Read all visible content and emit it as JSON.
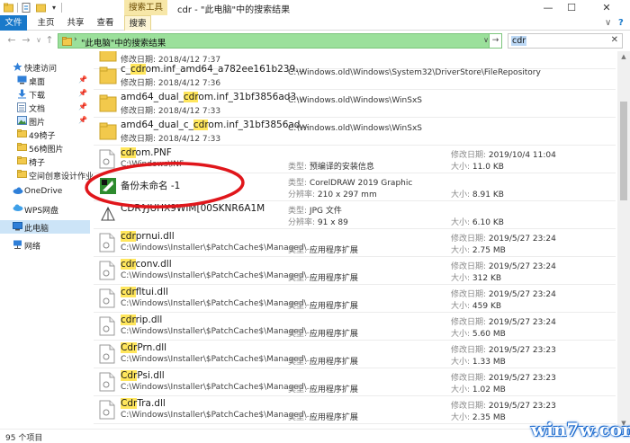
{
  "window": {
    "contextual_tab": "搜索工具",
    "title": "cdr - \"此电脑\"中的搜索结果",
    "minimize": "—",
    "maximize": "☐",
    "close": "✕"
  },
  "ribbon": {
    "tabs": [
      "文件",
      "主页",
      "共享",
      "查看",
      "搜索"
    ],
    "collapse": "∨",
    "help": "?"
  },
  "address_bar": {
    "arrow": "›",
    "location": "\"此电脑\"中的搜索结果",
    "dropdown": "∨",
    "refresh": "→"
  },
  "search": {
    "value": "cdr",
    "clear": "✕"
  },
  "nav_pane": {
    "quick_access": "快速访问",
    "pinned": [
      {
        "label": "桌面",
        "icon": "desktop-icon"
      },
      {
        "label": "下载",
        "icon": "download-icon"
      },
      {
        "label": "文档",
        "icon": "document-icon"
      },
      {
        "label": "图片",
        "icon": "picture-icon"
      }
    ],
    "folders": [
      "49椅子",
      "56椅图片",
      "椅子",
      "空间创意设计作业"
    ],
    "onedrive": "OneDrive",
    "wps": "WPS网盘",
    "this_pc": "此电脑",
    "network": "网络"
  },
  "files": [
    {
      "name": "",
      "sub": "修改日期: 2018/4/12 7:37",
      "path": "",
      "type": "",
      "date": "",
      "size": "",
      "icon": "folder-icon"
    },
    {
      "name": "c_cdrom.inf_amd64_a782ee161b239...",
      "hl": "cdr",
      "sub": "修改日期: 2018/4/12 7:36",
      "path": "C:\\Windows.old\\Windows\\System32\\DriverStore\\FileRepository",
      "type": "",
      "date": "",
      "size": "",
      "icon": "folder-icon"
    },
    {
      "name": "amd64_dual_cdrom.inf_31bf3856ad3...",
      "hl": "cdr",
      "sub": "修改日期: 2018/4/12 7:33",
      "path": "C:\\Windows.old\\Windows\\WinSxS",
      "type": "",
      "date": "",
      "size": "",
      "icon": "folder-icon"
    },
    {
      "name": "amd64_dual_c_cdrom.inf_31bf3856ad...",
      "hl": "cdr",
      "sub": "修改日期: 2018/4/12 7:33",
      "path": "C:\\Windows.old\\Windows\\WinSxS",
      "type": "",
      "date": "",
      "size": "",
      "icon": "folder-icon"
    },
    {
      "name": "cdrom.PNF",
      "hl": "cdr",
      "sub": "C:\\Windows\\INF",
      "path": "",
      "type": "预编译的安装信息",
      "type_label": "类型:",
      "date": "2019/10/4 11:04",
      "size": "11.0 KB",
      "icon": "file-icon"
    },
    {
      "name": "备份未命名 -1",
      "sub": "",
      "path": "",
      "type": "CorelDRAW 2019 Graphic",
      "type_label": "类型:",
      "extra_label": "分辨率:",
      "extra": "210 x 297 mm",
      "date": "",
      "size": "8.91 KB",
      "icon": "coreldraw-icon"
    },
    {
      "name": "CDR}JUHX9WIM[00SKNR6A1M",
      "sub": "",
      "path": "",
      "type": "JPG 文件",
      "type_label": "类型:",
      "extra_label": "分辨率:",
      "extra": "91 x 89",
      "date": "",
      "size": "6.10 KB",
      "icon": "image-icon"
    },
    {
      "name": "cdrprnui.dll",
      "hl": "cdr",
      "sub": "C:\\Windows\\Installer\\$PatchCache$\\Managed\\...",
      "path": "",
      "type": "应用程序扩展",
      "type_label": "类型:",
      "date": "2019/5/27 23:24",
      "size": "2.75 MB",
      "icon": "file-icon"
    },
    {
      "name": "cdrconv.dll",
      "hl": "cdr",
      "sub": "C:\\Windows\\Installer\\$PatchCache$\\Managed\\...",
      "path": "",
      "type": "应用程序扩展",
      "type_label": "类型:",
      "date": "2019/5/27 23:24",
      "size": "312 KB",
      "icon": "file-icon"
    },
    {
      "name": "cdrfltui.dll",
      "hl": "cdr",
      "sub": "C:\\Windows\\Installer\\$PatchCache$\\Managed\\...",
      "path": "",
      "type": "应用程序扩展",
      "type_label": "类型:",
      "date": "2019/5/27 23:24",
      "size": "459 KB",
      "icon": "file-icon"
    },
    {
      "name": "cdrrip.dll",
      "hl": "cdr",
      "sub": "C:\\Windows\\Installer\\$PatchCache$\\Managed\\...",
      "path": "",
      "type": "应用程序扩展",
      "type_label": "类型:",
      "date": "2019/5/27 23:24",
      "size": "5.60 MB",
      "icon": "file-icon"
    },
    {
      "name": "CdrPrn.dll",
      "hl": "Cdr",
      "sub": "C:\\Windows\\Installer\\$PatchCache$\\Managed\\...",
      "path": "",
      "type": "应用程序扩展",
      "type_label": "类型:",
      "date": "2019/5/27 23:23",
      "size": "1.33 MB",
      "icon": "file-icon"
    },
    {
      "name": "CdrPsi.dll",
      "hl": "Cdr",
      "sub": "C:\\Windows\\Installer\\$PatchCache$\\Managed\\...",
      "path": "",
      "type": "应用程序扩展",
      "type_label": "类型:",
      "date": "2019/5/27 23:23",
      "size": "1.02 MB",
      "icon": "file-icon"
    },
    {
      "name": "CdrTra.dll",
      "hl": "Cdr",
      "sub": "C:\\Windows\\Installer\\$PatchCache$\\Managed\\...",
      "path": "",
      "type": "应用程序扩展",
      "type_label": "类型:",
      "date": "2019/5/27 23:23",
      "size": "2.35 MB",
      "icon": "file-icon"
    }
  ],
  "labels": {
    "type": "类型:",
    "modified": "修改日期:",
    "size": "大小:",
    "resolution": "分辨率:"
  },
  "status": {
    "item_count": "95 个项目"
  },
  "watermark": "win7w.com",
  "colors": {
    "accent": "#1979ca",
    "address_bg": "#9be09b",
    "search_highlight": "#ffe65c",
    "annotation": "#e0161b"
  }
}
